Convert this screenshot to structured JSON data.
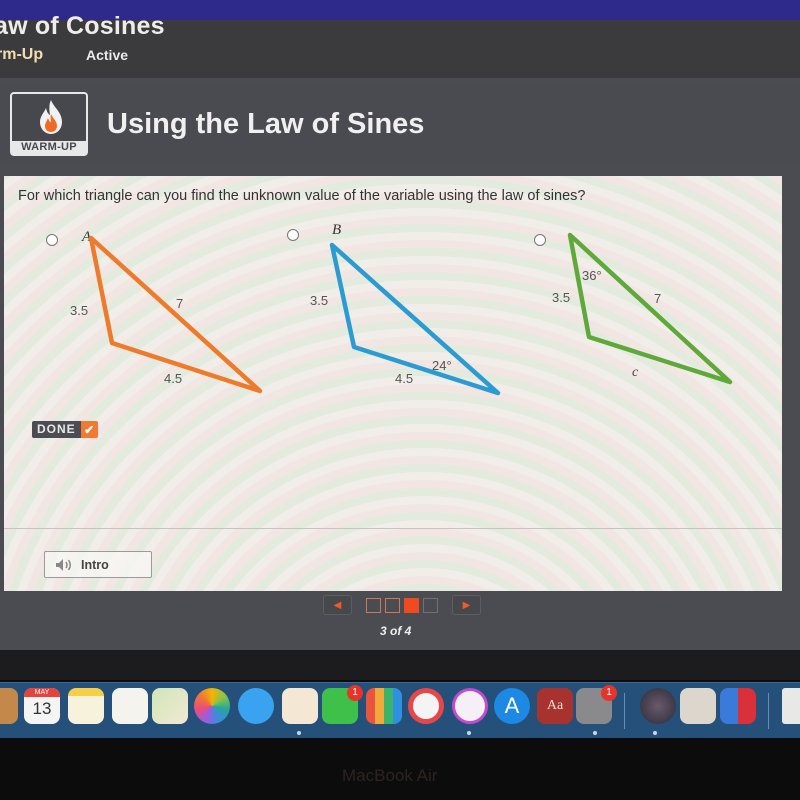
{
  "app": {
    "title": "aw of Cosines",
    "tabs": [
      {
        "label": "rm-Up"
      },
      {
        "label": "Active"
      }
    ]
  },
  "banner": {
    "badge_label": "WARM-UP",
    "title": "Using the Law of Sines"
  },
  "question": {
    "text": "For which triangle can you find the unknown value of the variable using the law of sines?",
    "options": [
      {
        "letter": "A",
        "color": "#ee7a2c",
        "sides": {
          "left": "3.5",
          "right": "7",
          "bottom": "4.5"
        }
      },
      {
        "letter": "B",
        "color": "#2b9bd2",
        "sides": {
          "left": "3.5",
          "bottom": "4.5"
        },
        "angle": "24°"
      },
      {
        "letter": "",
        "color": "#5fa83a",
        "sides": {
          "left": "3.5",
          "right": "7",
          "bottom": "c"
        },
        "angle": "36°"
      }
    ]
  },
  "done_button": {
    "label": "DONE",
    "icon": "check-icon"
  },
  "intro_button": {
    "label": "Intro",
    "icon": "speaker-icon"
  },
  "pager": {
    "current": 3,
    "total": 4,
    "label": "3 of 4",
    "prev_icon": "arrow-left-icon",
    "next_icon": "arrow-right-icon"
  },
  "dock": {
    "calendar_month": "MAY",
    "calendar_day": "13",
    "facetime_badge": "1",
    "preferences_badge": "1",
    "dictionary_label": "Aa"
  },
  "bezel": {
    "label": "MacBook Air"
  },
  "colors": {
    "accent": "#f05a28",
    "header_bg": "#3b3a3c",
    "content_bg": "#f1eeea",
    "dock_bg": "#24507a"
  }
}
